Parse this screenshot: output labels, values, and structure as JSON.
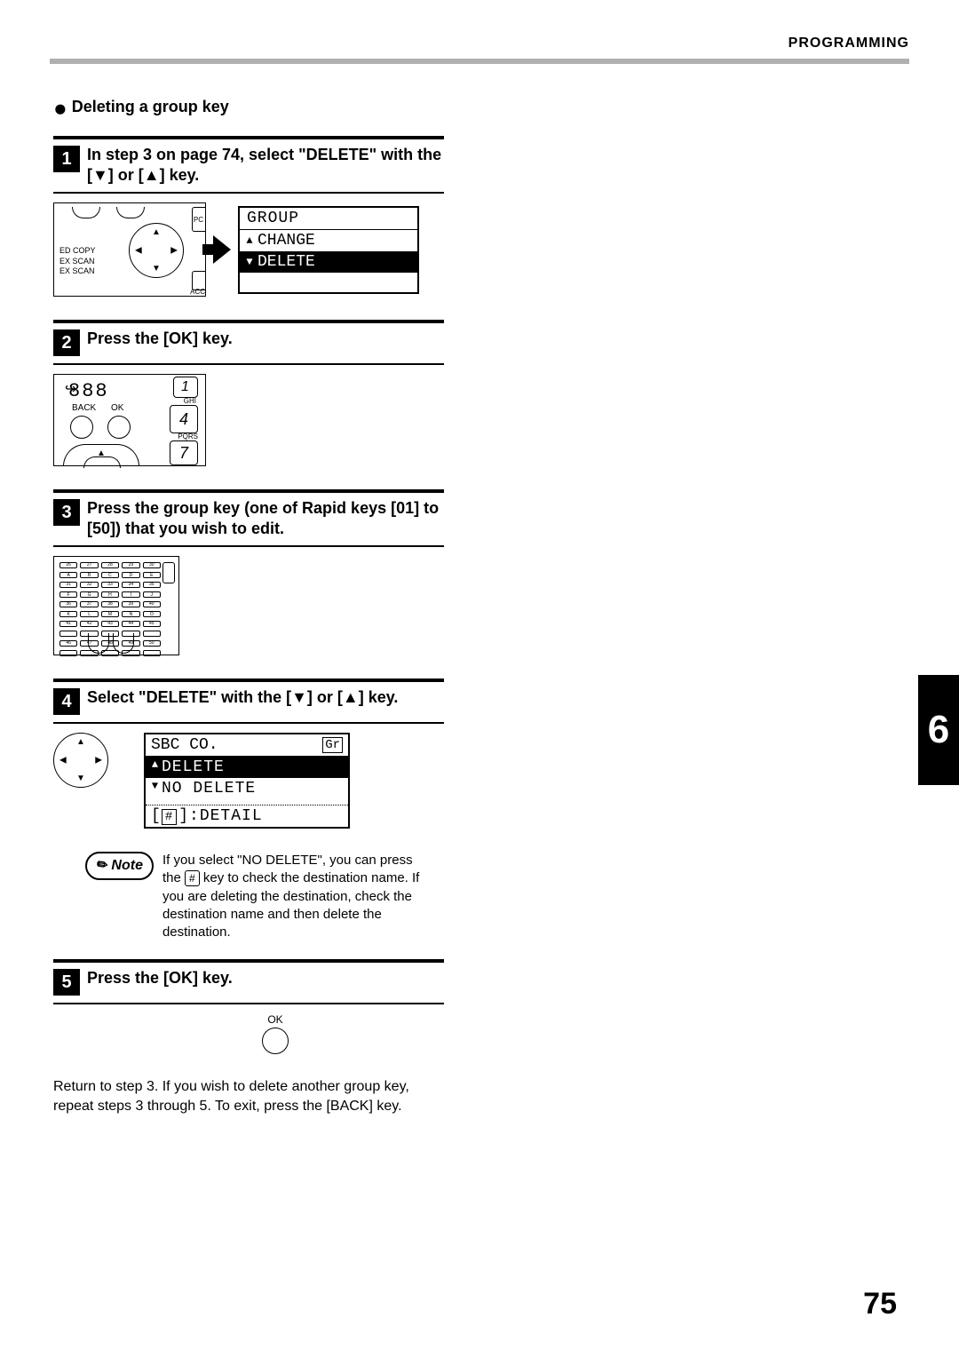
{
  "header": {
    "section": "PROGRAMMING"
  },
  "section_title": "Deleting a group key",
  "steps": {
    "s1": {
      "num": "1",
      "text": "In step 3 on page 74, select \"DELETE\" with the [▼] or [▲] key.",
      "panel": {
        "l1": "ED COPY",
        "l2": "EX SCAN",
        "l3": "EX SCAN",
        "top_right_label": "PC",
        "bottom_right_label": "ACC"
      },
      "screen": {
        "title": "GROUP",
        "item_up": "CHANGE",
        "item_down": "DELETE"
      }
    },
    "s2": {
      "num": "2",
      "text": "Press the [OK] key.",
      "panel": {
        "seg": "888",
        "back": "BACK",
        "ok": "OK",
        "key1": "1",
        "key4": "4",
        "key7": "7",
        "ghi": "GHI",
        "pqrs": "PQRS"
      }
    },
    "s3": {
      "num": "3",
      "text": "Press the group key (one of Rapid keys [01] to [50]) that you wish to edit.",
      "nums": [
        "26",
        "27",
        "28",
        "29",
        "30",
        "31",
        "32",
        "33",
        "34",
        "35",
        "36",
        "37",
        "38",
        "39",
        "40",
        "41",
        "42",
        "43",
        "44",
        "45",
        "46",
        "47",
        "48",
        "49",
        "50"
      ],
      "letters": [
        "A",
        "B",
        "C",
        "D",
        "E",
        "F",
        "G",
        "H",
        "I",
        "J",
        "K",
        "L",
        "M",
        "N",
        "O"
      ]
    },
    "s4": {
      "num": "4",
      "text": "Select \"DELETE\" with the [▼] or [▲] key.",
      "screen": {
        "title": "SBC CO.",
        "badge": "Gr",
        "item_up": "DELETE",
        "item_down": "NO DELETE",
        "foot_hash": "#",
        "foot": ":DETAIL"
      }
    },
    "note": {
      "label": "Note",
      "hash": "#",
      "text1": "If you select \"NO DELETE\", you can press the ",
      "text2": " key to check the destination name. If you are deleting the destination, check the destination name and then delete the destination."
    },
    "s5": {
      "num": "5",
      "text": "Press the [OK] key.",
      "ok": "OK"
    },
    "closing": "Return to step 3. If you wish to delete another group key, repeat steps 3 through 5. To exit, press the [BACK] key."
  },
  "chapter_tab": "6",
  "page_number": "75"
}
